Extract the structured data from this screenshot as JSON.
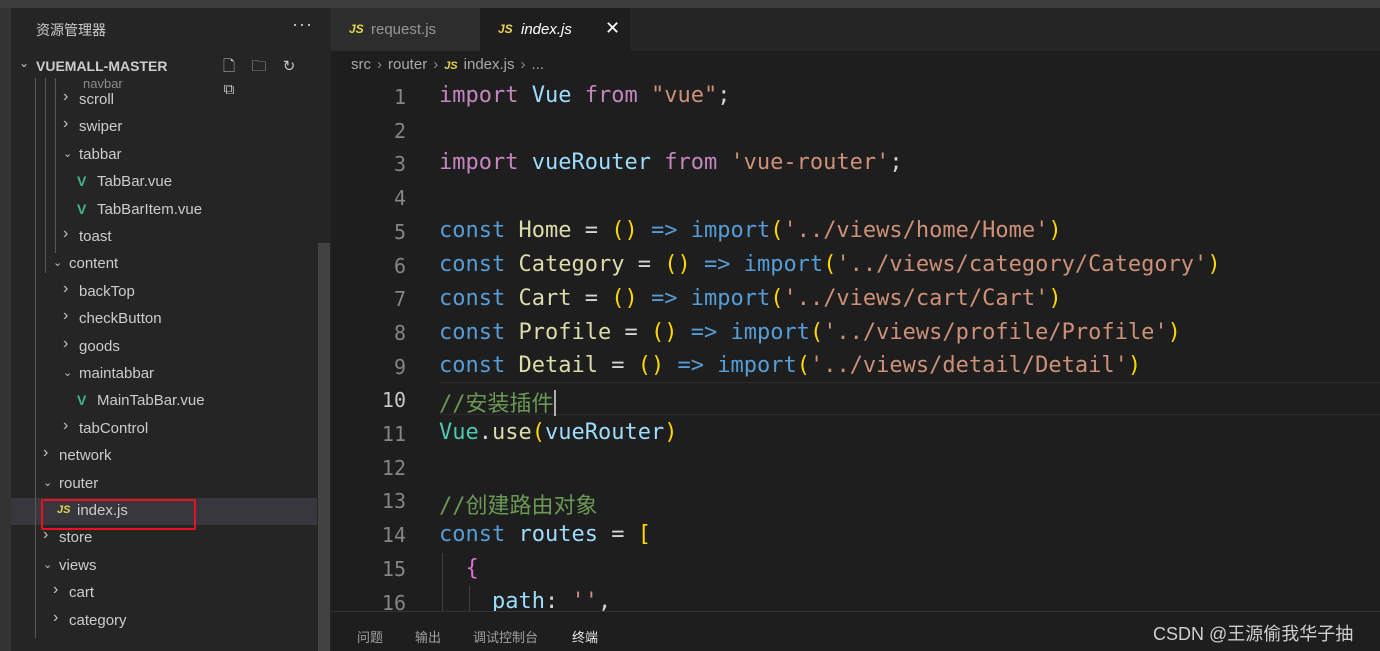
{
  "explorer": {
    "title": "资源管理器",
    "more": "···",
    "project": "VUEMALL-MASTER",
    "ghost_item": "navbar",
    "items": [
      {
        "label": "scroll",
        "kind": "folder",
        "open": false
      },
      {
        "label": "swiper",
        "kind": "folder",
        "open": false
      },
      {
        "label": "tabbar",
        "kind": "folder",
        "open": true
      },
      {
        "label": "TabBar.vue",
        "kind": "vue"
      },
      {
        "label": "TabBarItem.vue",
        "kind": "vue"
      },
      {
        "label": "toast",
        "kind": "folder",
        "open": false
      },
      {
        "label": "content",
        "kind": "folder",
        "open": true
      },
      {
        "label": "backTop",
        "kind": "folder",
        "open": false
      },
      {
        "label": "checkButton",
        "kind": "folder",
        "open": false
      },
      {
        "label": "goods",
        "kind": "folder",
        "open": false
      },
      {
        "label": "maintabbar",
        "kind": "folder",
        "open": true
      },
      {
        "label": "MainTabBar.vue",
        "kind": "vue"
      },
      {
        "label": "tabControl",
        "kind": "folder",
        "open": false
      },
      {
        "label": "network",
        "kind": "folder",
        "open": false
      },
      {
        "label": "router",
        "kind": "folder",
        "open": true
      },
      {
        "label": "index.js",
        "kind": "js",
        "selected": true
      },
      {
        "label": "store",
        "kind": "folder",
        "open": false
      },
      {
        "label": "views",
        "kind": "folder",
        "open": true
      },
      {
        "label": "cart",
        "kind": "folder",
        "open": false
      },
      {
        "label": "category",
        "kind": "folder",
        "open": false
      }
    ]
  },
  "tabs": [
    {
      "icon": "JS",
      "label": "request.js",
      "active": false
    },
    {
      "icon": "JS",
      "label": "index.js",
      "active": true,
      "close": "✕"
    }
  ],
  "breadcrumb": [
    "src",
    "router",
    "index.js",
    "..."
  ],
  "breadcrumb_icon": "JS",
  "editor": {
    "active_line": 10,
    "line_numbers": [
      "1",
      "2",
      "3",
      "4",
      "5",
      "6",
      "7",
      "8",
      "9",
      "10",
      "11",
      "12",
      "13",
      "14",
      "15",
      "16"
    ]
  },
  "panel": {
    "tabs": [
      "问题",
      "输出",
      "调试控制台",
      "终端"
    ],
    "active": "终端"
  },
  "watermark": "CSDN @王源偷我华子抽",
  "colors": {
    "keyword": "#569cd6",
    "control_keyword": "#c586c0",
    "variable": "#9cdcfe",
    "function": "#dcdcaa",
    "string": "#ce9178",
    "comment": "#6a9955",
    "highlight_box": "#e81123"
  }
}
